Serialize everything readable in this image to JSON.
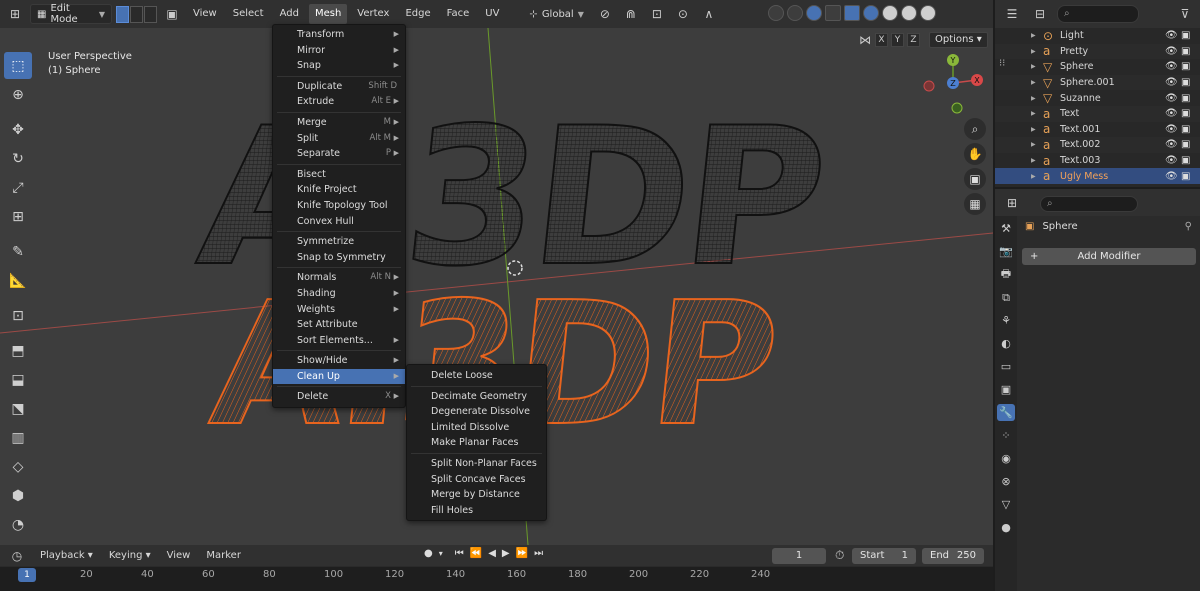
{
  "header": {
    "mode": "Edit Mode",
    "menus": [
      "View",
      "Select",
      "Add",
      "Mesh",
      "Vertex",
      "Edge",
      "Face",
      "UV"
    ],
    "orientation": "Global",
    "viewport_axes": [
      "X",
      "Y",
      "Z"
    ],
    "options": "Options"
  },
  "viewport": {
    "view_name": "User Perspective",
    "object_name": "(1) Sphere",
    "gizmo": {
      "x": "X",
      "y": "Y",
      "z": "Z"
    },
    "text_top": "AI3DP",
    "text_bottom": "AI3DP"
  },
  "mesh_menu": {
    "items": [
      {
        "label": "Transform",
        "shortcut": "",
        "submenu": true
      },
      {
        "label": "Mirror",
        "shortcut": "",
        "submenu": true
      },
      {
        "label": "Snap",
        "shortcut": "",
        "submenu": true
      },
      {
        "sep": true
      },
      {
        "label": "Duplicate",
        "shortcut": "Shift D",
        "submenu": false
      },
      {
        "label": "Extrude",
        "shortcut": "Alt E",
        "submenu": true
      },
      {
        "sep": true
      },
      {
        "label": "Merge",
        "shortcut": "M",
        "submenu": true
      },
      {
        "label": "Split",
        "shortcut": "Alt M",
        "submenu": true
      },
      {
        "label": "Separate",
        "shortcut": "P",
        "submenu": true
      },
      {
        "sep": true
      },
      {
        "label": "Bisect",
        "shortcut": "",
        "submenu": false
      },
      {
        "label": "Knife Project",
        "shortcut": "",
        "submenu": false
      },
      {
        "label": "Knife Topology Tool",
        "shortcut": "",
        "submenu": false
      },
      {
        "label": "Convex Hull",
        "shortcut": "",
        "submenu": false
      },
      {
        "sep": true
      },
      {
        "label": "Symmetrize",
        "shortcut": "",
        "submenu": false
      },
      {
        "label": "Snap to Symmetry",
        "shortcut": "",
        "submenu": false
      },
      {
        "sep": true
      },
      {
        "label": "Normals",
        "shortcut": "Alt N",
        "submenu": true
      },
      {
        "label": "Shading",
        "shortcut": "",
        "submenu": true
      },
      {
        "label": "Weights",
        "shortcut": "",
        "submenu": true
      },
      {
        "label": "Set Attribute",
        "shortcut": "",
        "submenu": false
      },
      {
        "label": "Sort Elements...",
        "shortcut": "",
        "submenu": true
      },
      {
        "sep": true
      },
      {
        "label": "Show/Hide",
        "shortcut": "",
        "submenu": true
      },
      {
        "label": "Clean Up",
        "shortcut": "",
        "submenu": true,
        "highlight": true
      },
      {
        "sep": true
      },
      {
        "label": "Delete",
        "shortcut": "X",
        "submenu": true
      }
    ]
  },
  "cleanup_menu": {
    "items": [
      {
        "label": "Delete Loose"
      },
      {
        "sep": true
      },
      {
        "label": "Decimate Geometry"
      },
      {
        "label": "Degenerate Dissolve"
      },
      {
        "label": "Limited Dissolve"
      },
      {
        "label": "Make Planar Faces"
      },
      {
        "sep": true
      },
      {
        "label": "Split Non-Planar Faces"
      },
      {
        "label": "Split Concave Faces"
      },
      {
        "label": "Merge by Distance"
      },
      {
        "label": "Fill Holes"
      }
    ]
  },
  "timeline": {
    "menus": [
      "Playback",
      "Keying",
      "View",
      "Marker"
    ],
    "current_frame": "1",
    "start_label": "Start",
    "start_value": "1",
    "end_label": "End",
    "end_value": "250",
    "ruler": [
      "1",
      "20",
      "40",
      "60",
      "80",
      "100",
      "120",
      "140",
      "160",
      "180",
      "200",
      "220",
      "240"
    ]
  },
  "outliner": {
    "rows": [
      {
        "name": "Light",
        "icon": "light-icon",
        "selected": false
      },
      {
        "name": "Pretty",
        "icon": "text-icon",
        "selected": false
      },
      {
        "name": "Sphere",
        "icon": "mesh-icon",
        "selected": false
      },
      {
        "name": "Sphere.001",
        "icon": "mesh-icon",
        "selected": false
      },
      {
        "name": "Suzanne",
        "icon": "mesh-icon",
        "selected": false
      },
      {
        "name": "Text",
        "icon": "text-icon",
        "selected": false
      },
      {
        "name": "Text.001",
        "icon": "text-icon",
        "selected": false
      },
      {
        "name": "Text.002",
        "icon": "text-icon",
        "selected": false
      },
      {
        "name": "Text.003",
        "icon": "text-icon",
        "selected": false
      },
      {
        "name": "Ugly Mess",
        "icon": "text-icon",
        "selected": true
      }
    ]
  },
  "properties": {
    "object": "Sphere",
    "add_modifier": "Add Modifier"
  },
  "colors": {
    "accent": "#4772b3",
    "wire_dark": "#1a1a1a",
    "wire_orange": "#e8641e",
    "selected_text": "#f4a259"
  }
}
